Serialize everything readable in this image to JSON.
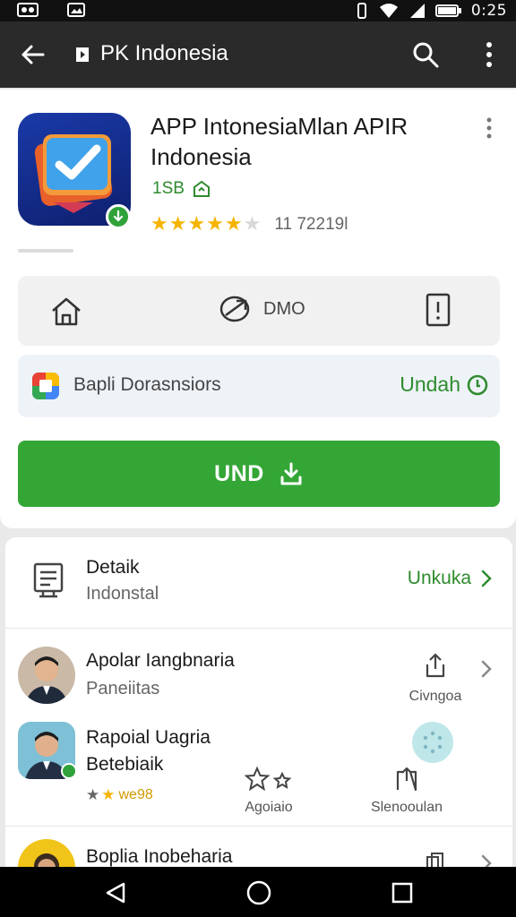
{
  "status_bar": {
    "time": "0:25"
  },
  "toolbar": {
    "title": "PK Indonesia"
  },
  "app": {
    "name_line1": "APP IntonesiaMlan APIR",
    "name_line2": "Indonesia",
    "sub": "1SB",
    "rating_count": "11 72219l",
    "rating_stars": 4.5
  },
  "actions": {
    "demo_label": "DMO"
  },
  "download_row": {
    "label": "Bapli Dorasnsiors",
    "action": "Undah"
  },
  "install_button": {
    "label": "UND"
  },
  "details": {
    "title": "Detaik",
    "subtitle": "Indonstal",
    "link": "Unkuka"
  },
  "people": [
    {
      "name": "Apolar Iangbnaria",
      "sub": "Paneiitas",
      "action_label": "Civngoa"
    },
    {
      "name_line1": "Rapoial Uagria",
      "name_line2": "Betebiaik",
      "rating_text": "we98"
    },
    {
      "name": "Boplia Inobeharia"
    }
  ],
  "card_actions": {
    "rate_label": "Agoiaio",
    "save_label": "Slenooulan"
  },
  "colors": {
    "accent_green": "#34a636",
    "toolbar": "#2a2a2a",
    "link_green": "#2e8b2e",
    "star": "#f5b400"
  }
}
